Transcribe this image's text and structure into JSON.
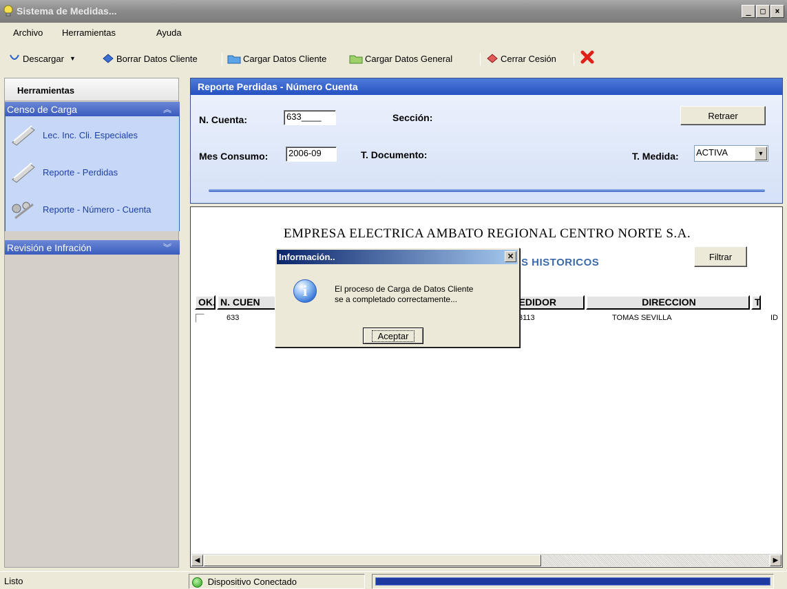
{
  "window": {
    "title": "Sistema de Medidas..."
  },
  "menu": [
    "Archivo",
    "Herramientas",
    "Ayuda"
  ],
  "toolbar": {
    "descargar": "Descargar",
    "borrar": "Borrar Datos Cliente",
    "cargar_cliente": "Cargar Datos Cliente",
    "cargar_general": "Cargar Datos General",
    "cerrar": "Cerrar Cesión"
  },
  "sidebar": {
    "header": "Herramientas",
    "group1": "Censo de Carga",
    "items": [
      {
        "label": "Lec. Inc. Cli. Especiales"
      },
      {
        "label": "Reporte - Perdidas"
      },
      {
        "label": "Reporte - Número - Cuenta"
      }
    ],
    "group2": "Revisión e Infración"
  },
  "report_panel": {
    "title": "Reporte Perdidas - Número Cuenta",
    "cuenta_label": "N. Cuenta:",
    "cuenta_value": "633____",
    "seccion_label": "Sección:",
    "retraer": "Retraer",
    "mes_label": "Mes Consumo:",
    "mes_value": "2006-09",
    "tdoc_label": "T. Documento:",
    "tmedida_label": "T. Medida:",
    "tmedida_value": "ACTIVA"
  },
  "report": {
    "company": "EMPRESA ELECTRICA AMBATO REGIONAL CENTRO NORTE S.A.",
    "subtitle": "S HISTORICOS",
    "filtrar": "Filtrar",
    "columns": [
      "OK.",
      "N. CUEN",
      "N. MEDIDOR",
      "DIRECCION",
      "T"
    ],
    "row": {
      "cuenta": "633",
      "medidor": "3113",
      "direccion": "TOMAS SEVILLA",
      "t": "ID"
    }
  },
  "dialog": {
    "title": "Información..",
    "message_line1": "El proceso de Carga de Datos Cliente",
    "message_line2": "se a completado correctamente...",
    "ok": "Aceptar"
  },
  "status": {
    "left": "Listo",
    "device": "Dispositivo Conectado",
    "progress": 1.0
  },
  "colors": {
    "accent": "#2552c2",
    "panel": "#d5e1f7",
    "close_red": "#e0201a"
  }
}
